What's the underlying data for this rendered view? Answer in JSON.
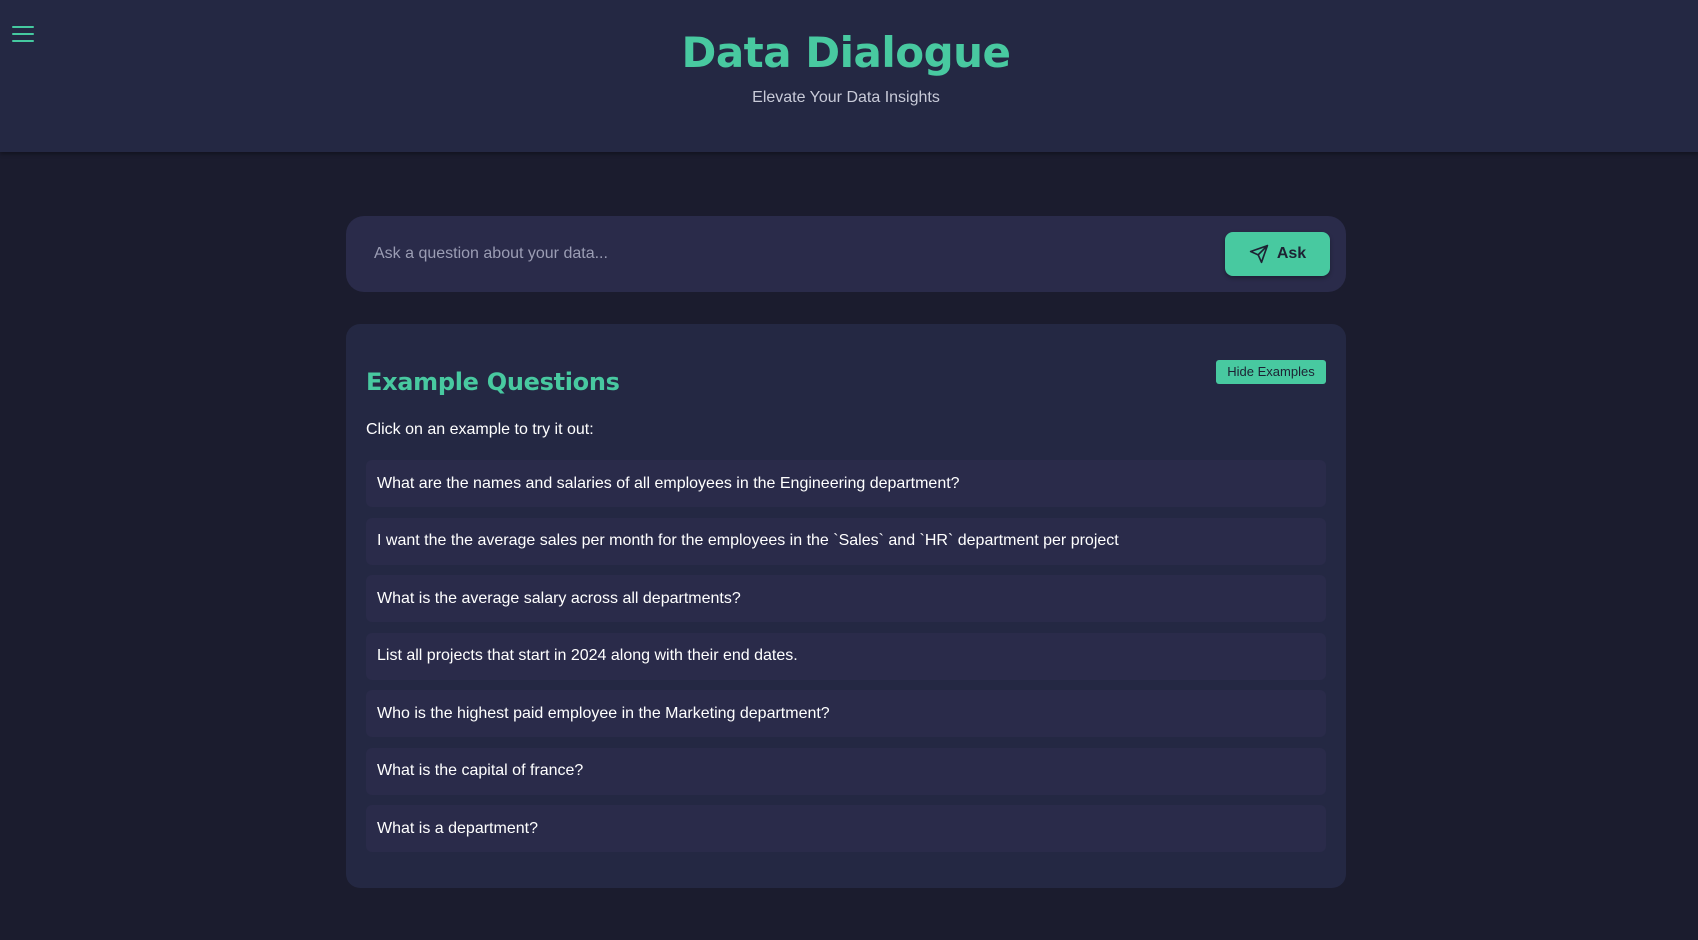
{
  "header": {
    "title": "Data Dialogue",
    "subtitle": "Elevate Your Data Insights",
    "menu_icon": "hamburger-menu-icon"
  },
  "search": {
    "placeholder": "Ask a question about your data...",
    "value": "",
    "ask_label": "Ask",
    "ask_icon": "send-icon"
  },
  "examples": {
    "title": "Example Questions",
    "hide_label": "Hide Examples",
    "hint": "Click on an example to try it out:",
    "items": [
      "What are the names and salaries of all employees in the Engineering department?",
      "I want the the average sales per month for the employees in the `Sales` and `HR` department per project",
      "What is the average salary across all departments?",
      "List all projects that start in 2024 along with their end dates.",
      "Who is the highest paid employee in the Marketing department?",
      "What is the capital of france?",
      "What is a department?"
    ]
  },
  "colors": {
    "accent": "#48c9a0",
    "background": "#1b1c2e",
    "header": "#242843",
    "card": "#2a2b4a"
  }
}
